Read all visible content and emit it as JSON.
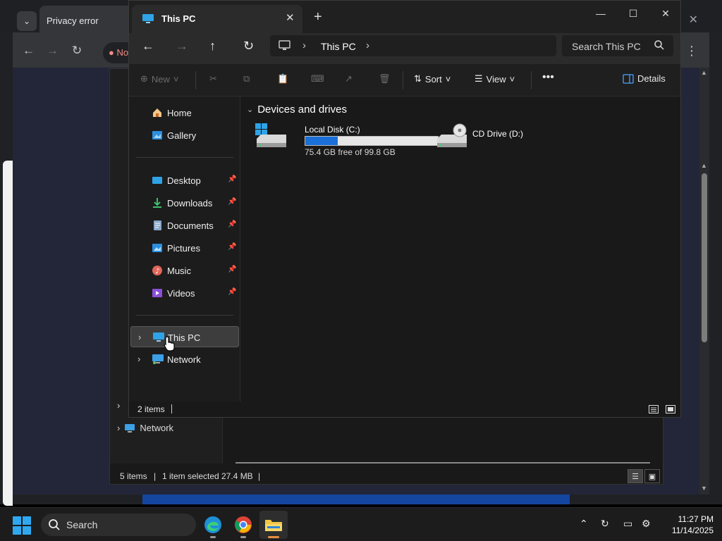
{
  "browser": {
    "tab_title": "Privacy error",
    "address_chip": "No"
  },
  "explorer_bg": {
    "sidebar_network": "Network",
    "status_items": "5 items",
    "status_selected": "1 item selected",
    "status_size": "27.4 MB"
  },
  "explorer": {
    "tab_title": "This PC",
    "address": {
      "location": "This PC"
    },
    "search": {
      "placeholder": "Search This PC"
    },
    "commands": {
      "new_label": "New",
      "sort_label": "Sort",
      "view_label": "View",
      "details_label": "Details"
    },
    "nav_pane": {
      "home": "Home",
      "gallery": "Gallery",
      "pinned": [
        {
          "label": "Desktop",
          "icon": "desktop-icon"
        },
        {
          "label": "Downloads",
          "icon": "downloads-icon"
        },
        {
          "label": "Documents",
          "icon": "documents-icon"
        },
        {
          "label": "Pictures",
          "icon": "pictures-icon"
        },
        {
          "label": "Music",
          "icon": "music-icon"
        },
        {
          "label": "Videos",
          "icon": "videos-icon"
        }
      ],
      "this_pc": "This PC",
      "network": "Network"
    },
    "content": {
      "group_title": "Devices and drives",
      "drives": [
        {
          "name": "Local Disk (C:)",
          "free_text": "75.4 GB free of 99.8 GB",
          "used_fraction": 0.245
        },
        {
          "name": "CD Drive (D:)"
        }
      ]
    },
    "status": {
      "item_count": "2 items"
    }
  },
  "taskbar": {
    "search_label": "Search",
    "time": "11:27 PM",
    "date": "11/14/2025"
  },
  "colors": {
    "accent": "#1a6fd8",
    "window_bg": "#191919",
    "explorer_active_indicator": "#e88d3c"
  }
}
